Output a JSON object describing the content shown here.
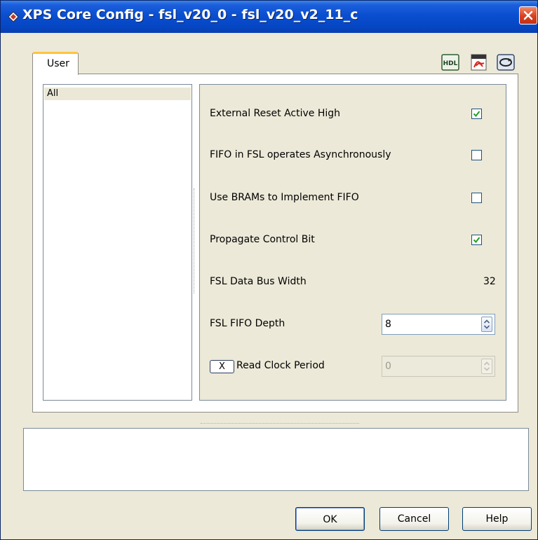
{
  "window": {
    "title": "XPS Core Config - fsl_v20_0 - fsl_v20_v2_11_c",
    "title_icon": "diamond-app-icon",
    "close_icon": "close-icon"
  },
  "tabs": [
    {
      "label": "User",
      "selected": true
    }
  ],
  "toolbar": {
    "hdl_label": "HDL",
    "pdf_icon": "pdf-icon",
    "refresh_icon": "refresh-icon"
  },
  "categories": [
    {
      "label": "All",
      "selected": true
    }
  ],
  "params": [
    {
      "label": "External Reset Active High",
      "type": "checkbox",
      "checked": true
    },
    {
      "label": "FIFO in FSL operates Asynchronously",
      "type": "checkbox",
      "checked": false
    },
    {
      "label": "Use BRAMs to Implement FIFO",
      "type": "checkbox",
      "checked": false
    },
    {
      "label": "Propagate Control Bit",
      "type": "checkbox",
      "checked": true
    },
    {
      "label": "FSL Data Bus Width",
      "type": "text",
      "value": "32"
    },
    {
      "label": "FSL FIFO Depth",
      "type": "spinner",
      "value": "8",
      "enabled": true
    },
    {
      "label": "Read Clock Period",
      "type": "spinner",
      "value": "0",
      "enabled": false,
      "toggle_label": "X"
    }
  ],
  "description": "",
  "buttons": {
    "ok": "OK",
    "cancel": "Cancel",
    "help": "Help"
  },
  "colors": {
    "title_bar": "#0a4fd0",
    "tab_accent": "#ffc33d",
    "close_button": "#d8401e"
  }
}
